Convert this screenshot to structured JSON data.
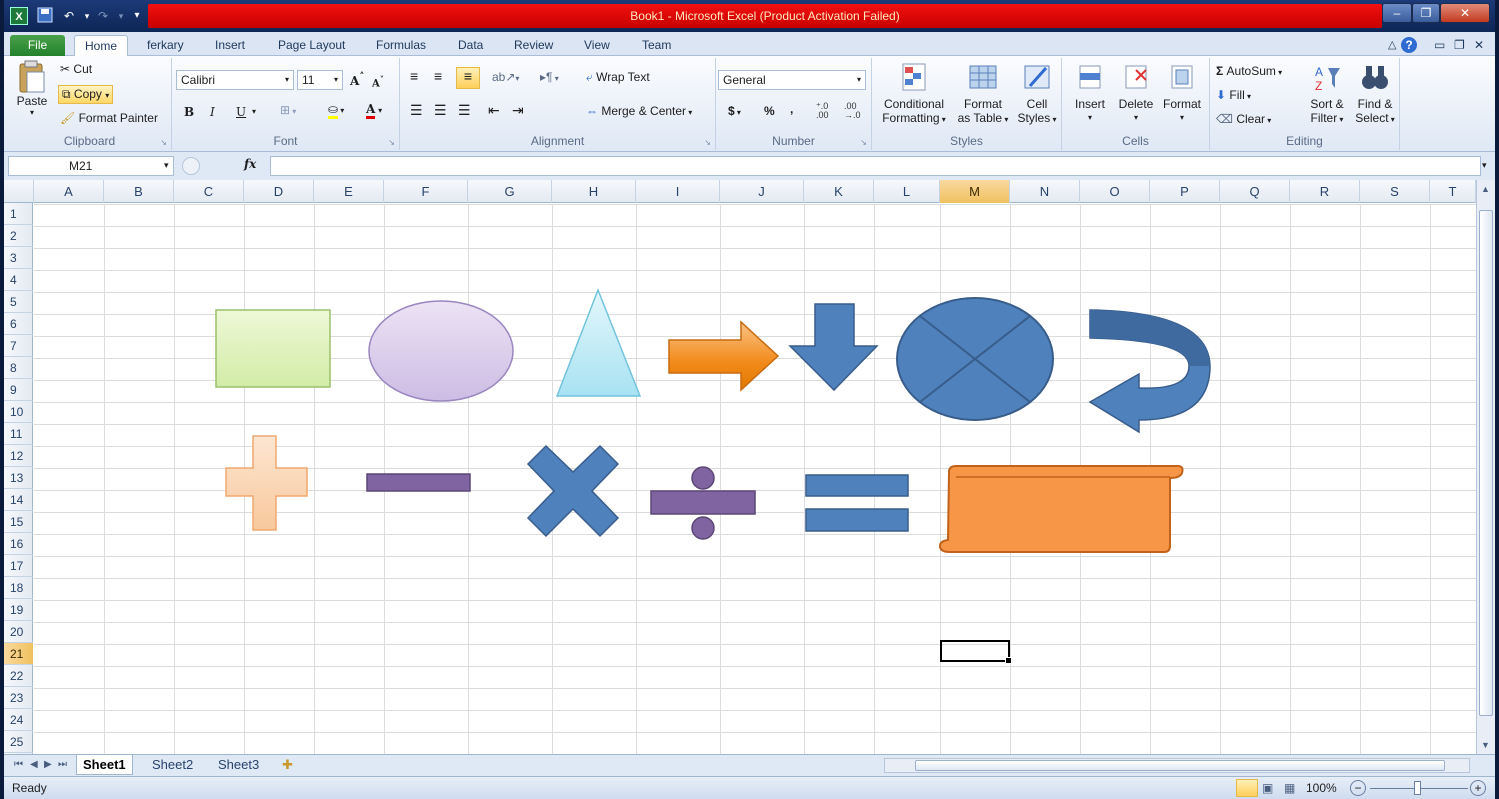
{
  "titlebar": {
    "title": "Book1  -  Microsoft Excel (Product Activation Failed)"
  },
  "tabs": [
    "File",
    "Home",
    "ferkary",
    "Insert",
    "Page Layout",
    "Formulas",
    "Data",
    "Review",
    "View",
    "Team"
  ],
  "clipboard": {
    "paste": "Paste",
    "cut": "Cut",
    "copy": "Copy",
    "format_painter": "Format Painter",
    "label": "Clipboard"
  },
  "font": {
    "name": "Calibri",
    "size": "11",
    "label": "Font",
    "bold": "B",
    "italic": "I",
    "underline": "U",
    "grow": "A",
    "shrink": "A",
    "color": "A"
  },
  "alignment": {
    "wrap": "Wrap Text",
    "merge": "Merge & Center",
    "label": "Alignment"
  },
  "number": {
    "format": "General",
    "currency": "$",
    "percent": "%",
    "comma": ",",
    "label": "Number"
  },
  "styles": {
    "cond1": "Conditional",
    "cond2": "Formatting",
    "fmt1": "Format",
    "fmt2": "as Table",
    "cell1": "Cell",
    "cell2": "Styles",
    "label": "Styles"
  },
  "cells": {
    "insert": "Insert",
    "delete": "Delete",
    "format": "Format",
    "label": "Cells"
  },
  "editing": {
    "autosum": "AutoSum",
    "fill": "Fill",
    "clear": "Clear",
    "sort1": "Sort &",
    "sort2": "Filter",
    "find1": "Find &",
    "find2": "Select",
    "label": "Editing"
  },
  "formula": {
    "name_box": "M21",
    "fx": "fx",
    "value": ""
  },
  "columns": [
    "A",
    "B",
    "C",
    "D",
    "E",
    "F",
    "G",
    "H",
    "I",
    "J",
    "K",
    "L",
    "M",
    "N",
    "O",
    "P",
    "Q",
    "R",
    "S",
    "T"
  ],
  "rows": [
    "1",
    "2",
    "3",
    "4",
    "5",
    "6",
    "7",
    "8",
    "9",
    "10",
    "11",
    "12",
    "13",
    "14",
    "15",
    "16",
    "17",
    "18",
    "19",
    "20",
    "21",
    "22",
    "23",
    "24",
    "25"
  ],
  "selected": {
    "column": "M",
    "row": "21"
  },
  "sheets": [
    "Sheet1",
    "Sheet2",
    "Sheet3"
  ],
  "status": {
    "text": "Ready",
    "zoom": "100%"
  },
  "colors": {
    "accent_red": "#e00000",
    "shape_blue": "#4f81bd",
    "shape_orange": "#f79646",
    "shape_purple": "#8064a2"
  }
}
